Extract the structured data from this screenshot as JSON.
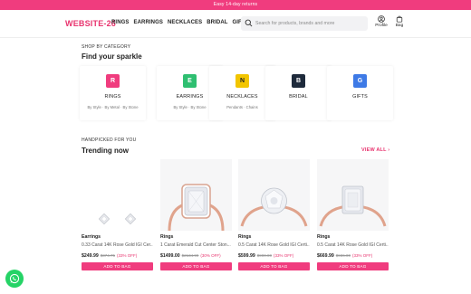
{
  "promo": {
    "text": "Easy 14-day returns"
  },
  "nav": {
    "logo": "WEBSITE-26",
    "menu": [
      "RINGS",
      "EARRINGS",
      "NECKLACES",
      "BRIDAL",
      "GIFTS"
    ],
    "search_placeholder": "Search for products, brands and more",
    "profile_label": "Profile",
    "bag_label": "Bag"
  },
  "categories_section": {
    "eyebrow": "SHOP BY CATEGORY",
    "title": "Find your sparkle",
    "items": [
      {
        "letter": "R",
        "name": "RINGS",
        "sub": "By Style · By Metal · By Stone",
        "color": "#f03c7e"
      },
      {
        "letter": "E",
        "name": "EARRINGS",
        "sub": "By Style · By Stone",
        "color": "#2fbf71"
      },
      {
        "letter": "N",
        "name": "NECKLACES",
        "sub": "Pendants · Chains",
        "color": "#f2c500"
      },
      {
        "letter": "B",
        "name": "BRIDAL",
        "sub": "",
        "color": "#1e2a3b"
      },
      {
        "letter": "G",
        "name": "GIFTS",
        "sub": "",
        "color": "#3e7ae6"
      }
    ]
  },
  "trending_section": {
    "eyebrow": "HANDPICKED FOR YOU",
    "title": "Trending now",
    "view_all": "VIEW ALL ›",
    "products": [
      {
        "category": "Earrings",
        "title": "0.33 Carat 14K Rose Gold IGI Cer...",
        "price": "$249.99",
        "old_price": "$374.75",
        "discount": "(33% OFF)",
        "button": "ADD TO BAG"
      },
      {
        "category": "Rings",
        "title": "1 Carat Emerald Cut Center Ston...",
        "price": "$1499.00",
        "old_price": "$2134.99",
        "discount": "(30% OFF)",
        "button": "ADD TO BAG"
      },
      {
        "category": "Rings",
        "title": "0.5 Carat 14K Rose Gold IGI Certi...",
        "price": "$599.99",
        "old_price": "$900.00",
        "discount": "(33% OFF)",
        "button": "ADD TO BAG"
      },
      {
        "category": "Rings",
        "title": "0.5 Carat 14K Rose Gold IGI Certi...",
        "price": "$669.99",
        "old_price": "$936.00",
        "discount": "(33% OFF)",
        "button": "ADD TO BAG"
      }
    ]
  },
  "colors": {
    "accent": "#f03c7e",
    "brand": "#e8336e",
    "whatsapp": "#25d366"
  }
}
